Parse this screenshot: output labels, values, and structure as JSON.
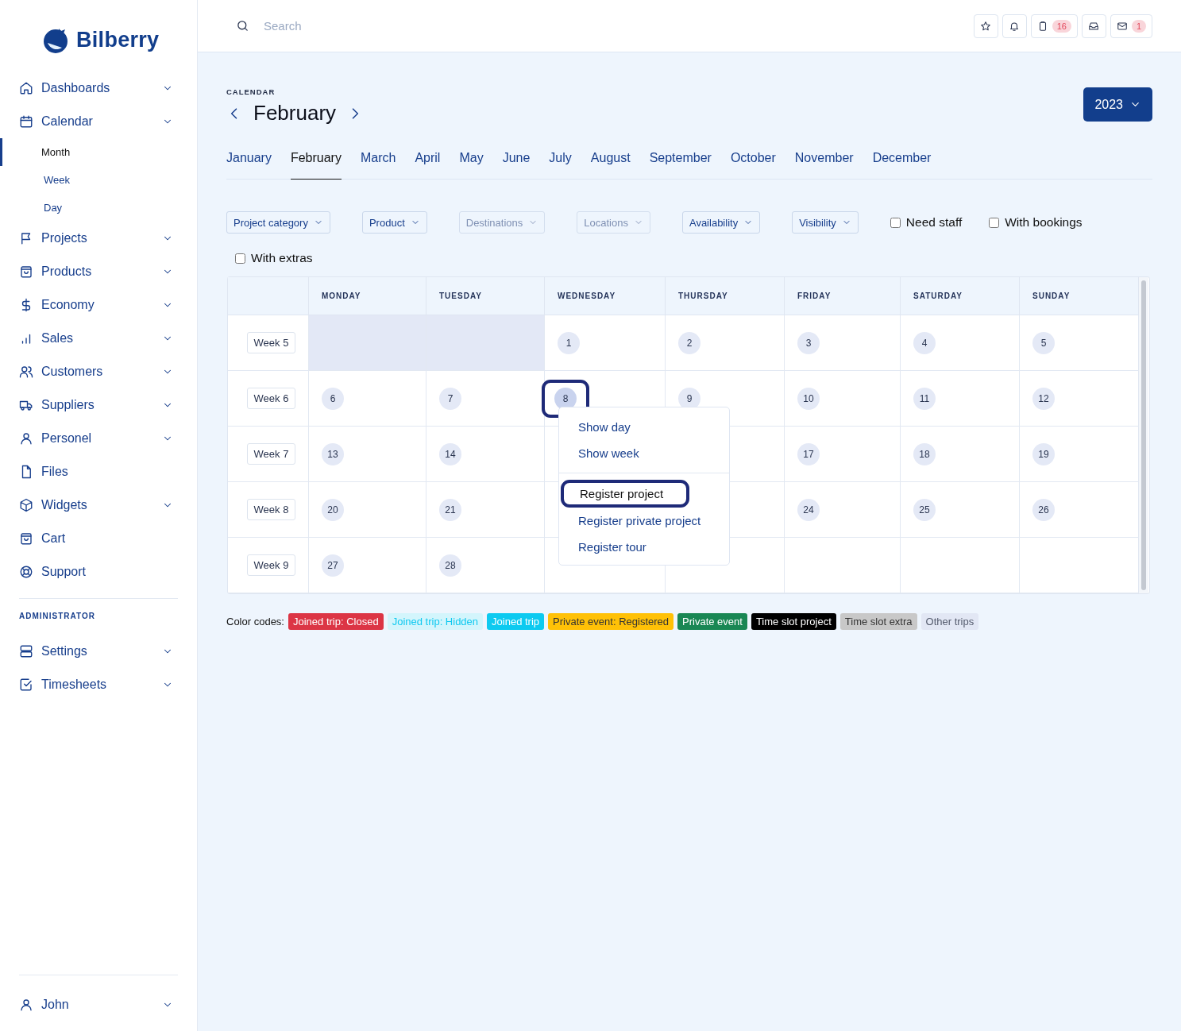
{
  "sidebar": {
    "logo": "Bilberry",
    "nav": [
      {
        "label": "Dashboards",
        "expandable": true
      },
      {
        "label": "Calendar",
        "expandable": true,
        "children": [
          {
            "label": "Month",
            "selected": true
          },
          {
            "label": "Week",
            "selected": false
          },
          {
            "label": "Day",
            "selected": false
          }
        ]
      },
      {
        "label": "Projects",
        "expandable": true
      },
      {
        "label": "Products",
        "expandable": true
      },
      {
        "label": "Economy",
        "expandable": true
      },
      {
        "label": "Sales",
        "expandable": true
      },
      {
        "label": "Customers",
        "expandable": true
      },
      {
        "label": "Suppliers",
        "expandable": true
      },
      {
        "label": "Personel",
        "expandable": true
      },
      {
        "label": "Files",
        "expandable": false
      },
      {
        "label": "Widgets",
        "expandable": true
      },
      {
        "label": "Cart",
        "expandable": false
      },
      {
        "label": "Support",
        "expandable": false
      }
    ],
    "section_title": "ADMINISTRATOR",
    "admin": [
      {
        "label": "Settings",
        "expandable": true
      },
      {
        "label": "Timesheets",
        "expandable": true
      }
    ],
    "user": {
      "label": "John",
      "expandable": true
    }
  },
  "topbar": {
    "search": {
      "placeholder": "Search"
    },
    "buttons": [
      {
        "kind": "star"
      },
      {
        "kind": "bell"
      },
      {
        "kind": "clipboard",
        "badge": "16"
      },
      {
        "kind": "inbox"
      },
      {
        "kind": "mail",
        "badge": "1"
      }
    ]
  },
  "calendar": {
    "eyebrow": "CALENDAR",
    "month": "February",
    "year": "2023",
    "months": [
      {
        "label": "January",
        "selected": false
      },
      {
        "label": "February",
        "selected": true
      },
      {
        "label": "March",
        "selected": false
      },
      {
        "label": "April",
        "selected": false
      },
      {
        "label": "May",
        "selected": false
      },
      {
        "label": "June",
        "selected": false
      },
      {
        "label": "July",
        "selected": false
      },
      {
        "label": "August",
        "selected": false
      },
      {
        "label": "September",
        "selected": false
      },
      {
        "label": "October",
        "selected": false
      },
      {
        "label": "November",
        "selected": false
      },
      {
        "label": "December",
        "selected": false
      }
    ],
    "filters": [
      {
        "label": "Project category",
        "disabled": false
      },
      {
        "label": "Product",
        "disabled": false
      },
      {
        "label": "Destinations",
        "disabled": true
      },
      {
        "label": "Locations",
        "disabled": true
      },
      {
        "label": "Availability",
        "disabled": false
      },
      {
        "label": "Visibility",
        "disabled": false
      }
    ],
    "checkboxes": [
      {
        "label": "Need staff",
        "checked": false
      },
      {
        "label": "With bookings",
        "checked": false
      },
      {
        "label": "With extras",
        "checked": false
      }
    ],
    "columns": [
      "MONDAY",
      "TUESDAY",
      "WEDNESDAY",
      "THURSDAY",
      "FRIDAY",
      "SATURDAY",
      "SUNDAY"
    ],
    "weeks": [
      {
        "label": "Week 5",
        "days": [
          {
            "kind": "outside"
          },
          {
            "kind": "outside"
          },
          {
            "kind": "day",
            "number": "1",
            "focused": false
          },
          {
            "kind": "day",
            "number": "2",
            "focused": false
          },
          {
            "kind": "day",
            "number": "3",
            "focused": false
          },
          {
            "kind": "day",
            "number": "4",
            "focused": false
          },
          {
            "kind": "day",
            "number": "5",
            "focused": false
          }
        ]
      },
      {
        "label": "Week 6",
        "days": [
          {
            "kind": "day",
            "number": "6",
            "focused": false
          },
          {
            "kind": "day",
            "number": "7",
            "focused": false
          },
          {
            "kind": "day",
            "number": "8",
            "focused": true
          },
          {
            "kind": "day",
            "number": "9",
            "focused": false
          },
          {
            "kind": "day",
            "number": "10",
            "focused": false
          },
          {
            "kind": "day",
            "number": "11",
            "focused": false
          },
          {
            "kind": "day",
            "number": "12",
            "focused": false
          }
        ]
      },
      {
        "label": "Week 7",
        "days": [
          {
            "kind": "day",
            "number": "13",
            "focused": false
          },
          {
            "kind": "day",
            "number": "14",
            "focused": false
          },
          {
            "kind": "blank"
          },
          {
            "kind": "blank"
          },
          {
            "kind": "day",
            "number": "17",
            "focused": false
          },
          {
            "kind": "day",
            "number": "18",
            "focused": false
          },
          {
            "kind": "day",
            "number": "19",
            "focused": false
          }
        ]
      },
      {
        "label": "Week 8",
        "days": [
          {
            "kind": "day",
            "number": "20",
            "focused": false
          },
          {
            "kind": "day",
            "number": "21",
            "focused": false
          },
          {
            "kind": "blank"
          },
          {
            "kind": "blank"
          },
          {
            "kind": "day",
            "number": "24",
            "focused": false
          },
          {
            "kind": "day",
            "number": "25",
            "focused": false
          },
          {
            "kind": "day",
            "number": "26",
            "focused": false
          }
        ]
      },
      {
        "label": "Week 9",
        "days": [
          {
            "kind": "day",
            "number": "27",
            "focused": false
          },
          {
            "kind": "day",
            "number": "28",
            "focused": false
          },
          {
            "kind": "blank"
          },
          {
            "kind": "blank"
          },
          {
            "kind": "blank"
          },
          {
            "kind": "blank"
          },
          {
            "kind": "blank"
          }
        ]
      }
    ],
    "menu": [
      [
        {
          "label": "Show day",
          "focused": false
        },
        {
          "label": "Show week",
          "focused": false
        }
      ],
      [
        {
          "label": "Register project",
          "focused": true
        },
        {
          "label": "Register private project",
          "focused": false
        },
        {
          "label": "Register tour",
          "focused": false
        }
      ]
    ],
    "legend_label": "Color codes:",
    "legend": [
      {
        "label": "Joined trip: Closed",
        "color": "#dc3545"
      },
      {
        "label": "Joined trip: Hidden",
        "color": "#d3f5fc"
      },
      {
        "label": "Joined trip",
        "color": "#0dcaf0"
      },
      {
        "label": "Private event: Registered",
        "color": "#ffc107"
      },
      {
        "label": "Private event",
        "color": "#198754"
      },
      {
        "label": "Time slot project",
        "color": "#000000"
      },
      {
        "label": "Time slot extra",
        "color": "#c8c8c8"
      },
      {
        "label": "Other trips",
        "color": "#e2e7f4"
      }
    ]
  }
}
